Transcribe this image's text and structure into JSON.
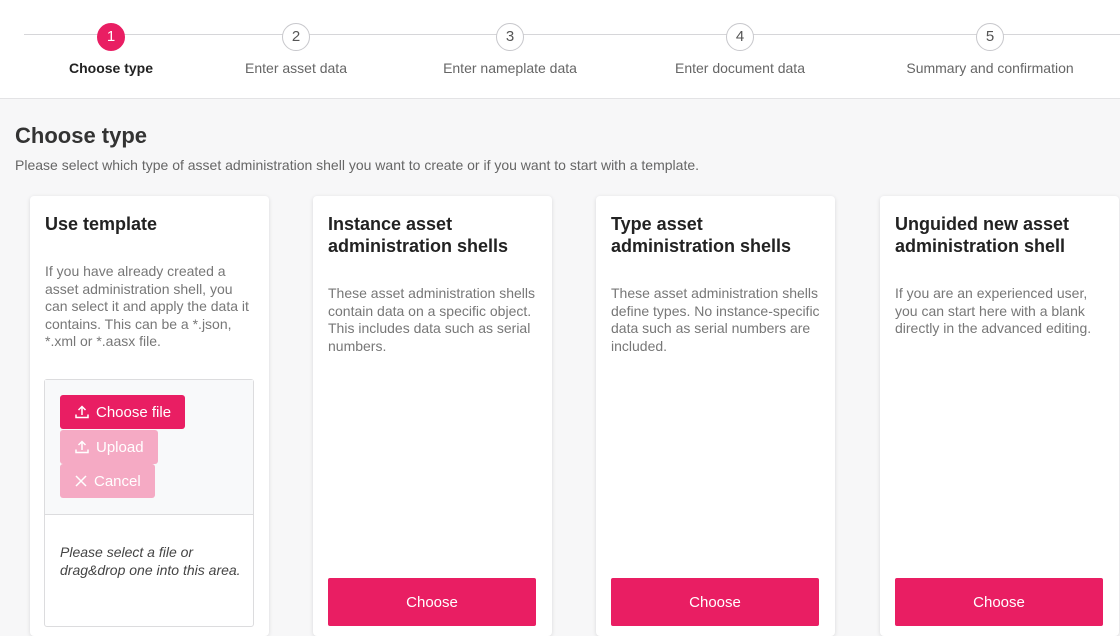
{
  "stepper": {
    "steps": [
      {
        "number": "1",
        "label": "Choose type"
      },
      {
        "number": "2",
        "label": "Enter asset data"
      },
      {
        "number": "3",
        "label": "Enter nameplate data"
      },
      {
        "number": "4",
        "label": "Enter document data"
      },
      {
        "number": "5",
        "label": "Summary and confirmation"
      }
    ],
    "active_step": 1
  },
  "page": {
    "title": "Choose type",
    "subtitle": "Please select which type of asset administration shell you want to create or if you want to start with a template."
  },
  "cards": {
    "template": {
      "title": "Use template",
      "description": "If you have already created a asset administration shell, you can select it and apply the data it contains. This can be a *.json, *.xml or *.aasx file.",
      "choose_file_label": "Choose file",
      "upload_label": "Upload",
      "cancel_label": "Cancel",
      "upload_hint": "Please select a file or drag&drop one into this area."
    },
    "instance": {
      "title": "Instance asset administration shells",
      "description": "These asset administration shells contain data on a specific object. This includes data such as serial numbers.",
      "button_label": "Choose"
    },
    "type": {
      "title": "Type asset administration shells",
      "description": "These asset administration shells define types. No instance-specific data such as serial numbers are included.",
      "button_label": "Choose"
    },
    "unguided": {
      "title": "Unguided new asset administration shell",
      "description": "If you are an experienced user, you can start here with a blank directly in the advanced editing.",
      "button_label": "Choose"
    }
  },
  "colors": {
    "accent": "#e91e63",
    "accent_disabled": "#f5aac4"
  },
  "icons": {
    "choose_file": "upload-icon",
    "upload": "upload-icon",
    "cancel": "close-icon"
  }
}
